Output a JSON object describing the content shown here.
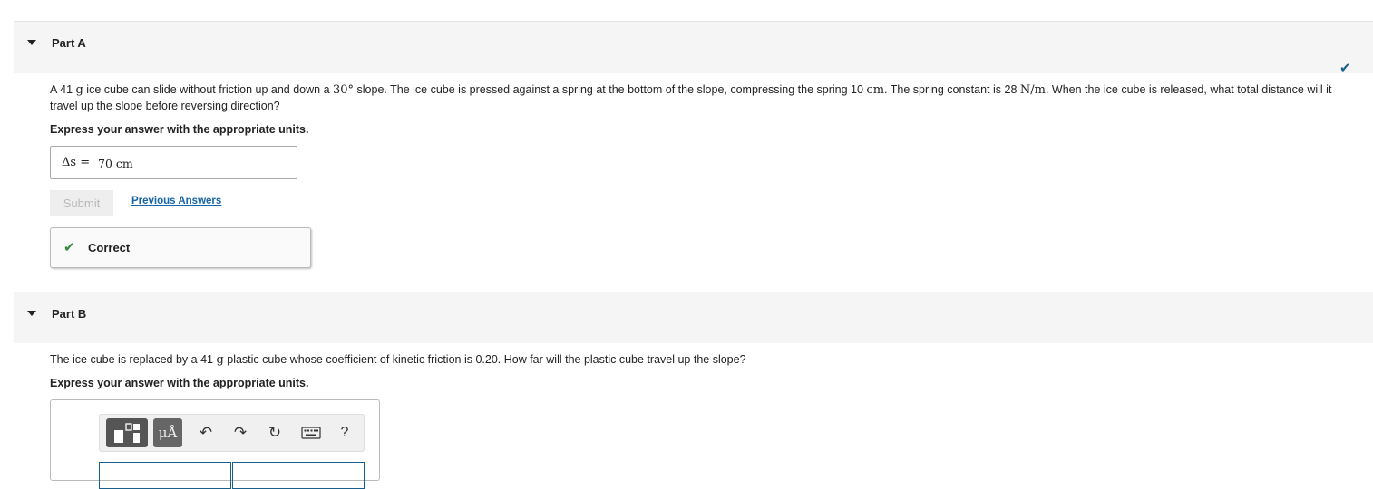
{
  "part_a": {
    "title": "Part A",
    "prompt_1": "A 41 ",
    "mass_unit": "g",
    "prompt_2": " ice cube can slide without friction up and down a ",
    "angle": "30°",
    "prompt_3": " slope. The ice cube is pressed against a spring at the bottom of the slope, compressing the spring 10 ",
    "compression_unit": "cm",
    "prompt_4": ". The spring constant is 28 ",
    "spring_unit": "N/m",
    "prompt_5": ". When the ice cube is released, what total distance will it travel up the slope before reversing direction?",
    "instruction": "Express your answer with the appropriate units.",
    "answer_variable": "Δs =",
    "answer_value": "70 cm",
    "submit_label": "Submit",
    "previous_answers_label": "Previous Answers",
    "feedback_label": "Correct"
  },
  "part_b": {
    "title": "Part B",
    "prompt_1": "The ice cube is replaced by a 41 ",
    "mass_unit": "g",
    "prompt_2": " plastic cube whose coefficient of kinetic friction is 0.20. How far will the plastic cube travel up the slope?",
    "instruction": "Express your answer with the appropriate units.",
    "toolbar": {
      "units_label": "μÅ",
      "undo_symbol": "↶",
      "redo_symbol": "↷",
      "reset_symbol": "↻",
      "help_label": "?"
    }
  },
  "colors": {
    "link": "#1565a8",
    "correct": "#2e8b3a",
    "header_bg": "#f5f5f5",
    "complete_check": "#1a5f8c"
  },
  "icons": [
    "collapse-caret-icon",
    "complete-check-icon",
    "correct-check-icon",
    "templates-icon",
    "units-icon",
    "undo-icon",
    "redo-icon",
    "reset-icon",
    "keyboard-icon",
    "help-icon"
  ]
}
